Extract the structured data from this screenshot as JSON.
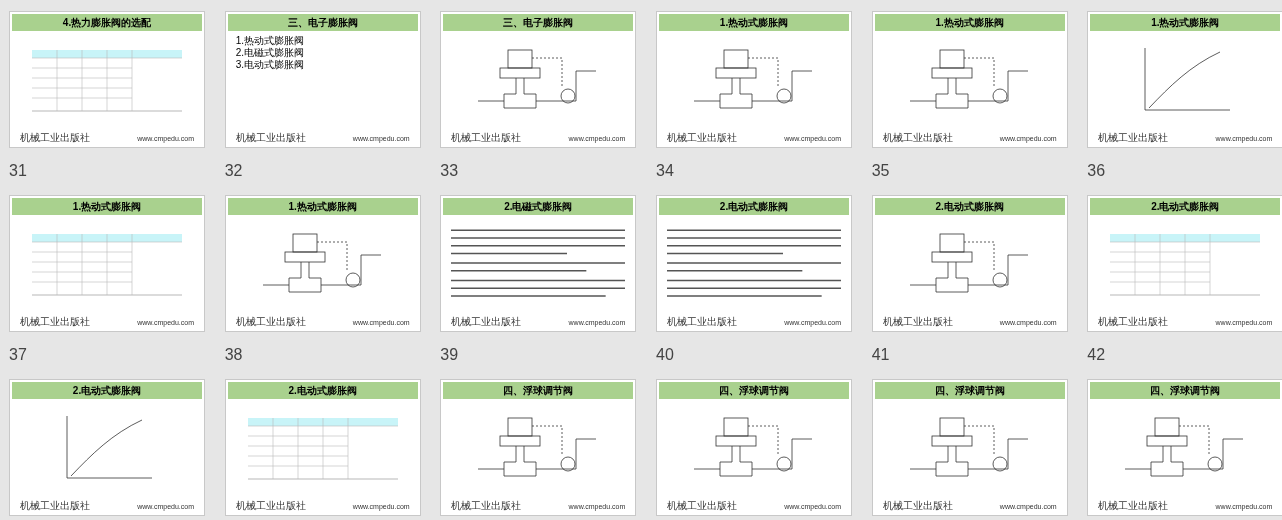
{
  "slides": [
    {
      "number": "31",
      "title": "4.热力膨胀阀的选配",
      "kind": "table",
      "logo": "机械工业出版社",
      "url": "www.cmpedu.com"
    },
    {
      "number": "32",
      "title": "三、电子膨胀阀",
      "kind": "list",
      "items": [
        "1.热动式膨胀阀",
        "2.电磁式膨胀阀",
        "3.电动式膨胀阀"
      ],
      "logo": "机械工业出版社",
      "url": "www.cmpedu.com"
    },
    {
      "number": "33",
      "title": "三、电子膨胀阀",
      "kind": "diagram",
      "logo": "机械工业出版社",
      "url": "www.cmpedu.com"
    },
    {
      "number": "34",
      "title": "1.热动式膨胀阀",
      "kind": "diagram",
      "logo": "机械工业出版社",
      "url": "www.cmpedu.com"
    },
    {
      "number": "35",
      "title": "1.热动式膨胀阀",
      "kind": "diagram",
      "logo": "机械工业出版社",
      "url": "www.cmpedu.com"
    },
    {
      "number": "36",
      "title": "1.热动式膨胀阀",
      "kind": "chart",
      "logo": "机械工业出版社",
      "url": "www.cmpedu.com"
    },
    {
      "number": "37",
      "title": "1.热动式膨胀阀",
      "kind": "table",
      "logo": "机械工业出版社",
      "url": "www.cmpedu.com"
    },
    {
      "number": "38",
      "title": "1.热动式膨胀阀",
      "kind": "diagram",
      "logo": "机械工业出版社",
      "url": "www.cmpedu.com"
    },
    {
      "number": "39",
      "title": "2.电磁式膨胀阀",
      "kind": "text",
      "logo": "机械工业出版社",
      "url": "www.cmpedu.com"
    },
    {
      "number": "40",
      "title": "2.电动式膨胀阀",
      "kind": "text",
      "logo": "机械工业出版社",
      "url": "www.cmpedu.com"
    },
    {
      "number": "41",
      "title": "2.电动式膨胀阀",
      "kind": "diagram",
      "logo": "机械工业出版社",
      "url": "www.cmpedu.com"
    },
    {
      "number": "42",
      "title": "2.电动式膨胀阀",
      "kind": "table",
      "logo": "机械工业出版社",
      "url": "www.cmpedu.com"
    },
    {
      "title": "2.电动式膨胀阀",
      "kind": "chart",
      "logo": "机械工业出版社",
      "url": "www.cmpedu.com"
    },
    {
      "title": "2.电动式膨胀阀",
      "kind": "table",
      "logo": "机械工业出版社",
      "url": "www.cmpedu.com"
    },
    {
      "title": "四、浮球调节阀",
      "kind": "diagram",
      "logo": "机械工业出版社",
      "url": "www.cmpedu.com"
    },
    {
      "title": "四、浮球调节阀",
      "kind": "diagram",
      "logo": "机械工业出版社",
      "url": "www.cmpedu.com"
    },
    {
      "title": "四、浮球调节阀",
      "kind": "diagram",
      "logo": "机械工业出版社",
      "url": "www.cmpedu.com"
    },
    {
      "title": "四、浮球调节阀",
      "kind": "diagram",
      "logo": "机械工业出版社",
      "url": "www.cmpedu.com"
    }
  ]
}
